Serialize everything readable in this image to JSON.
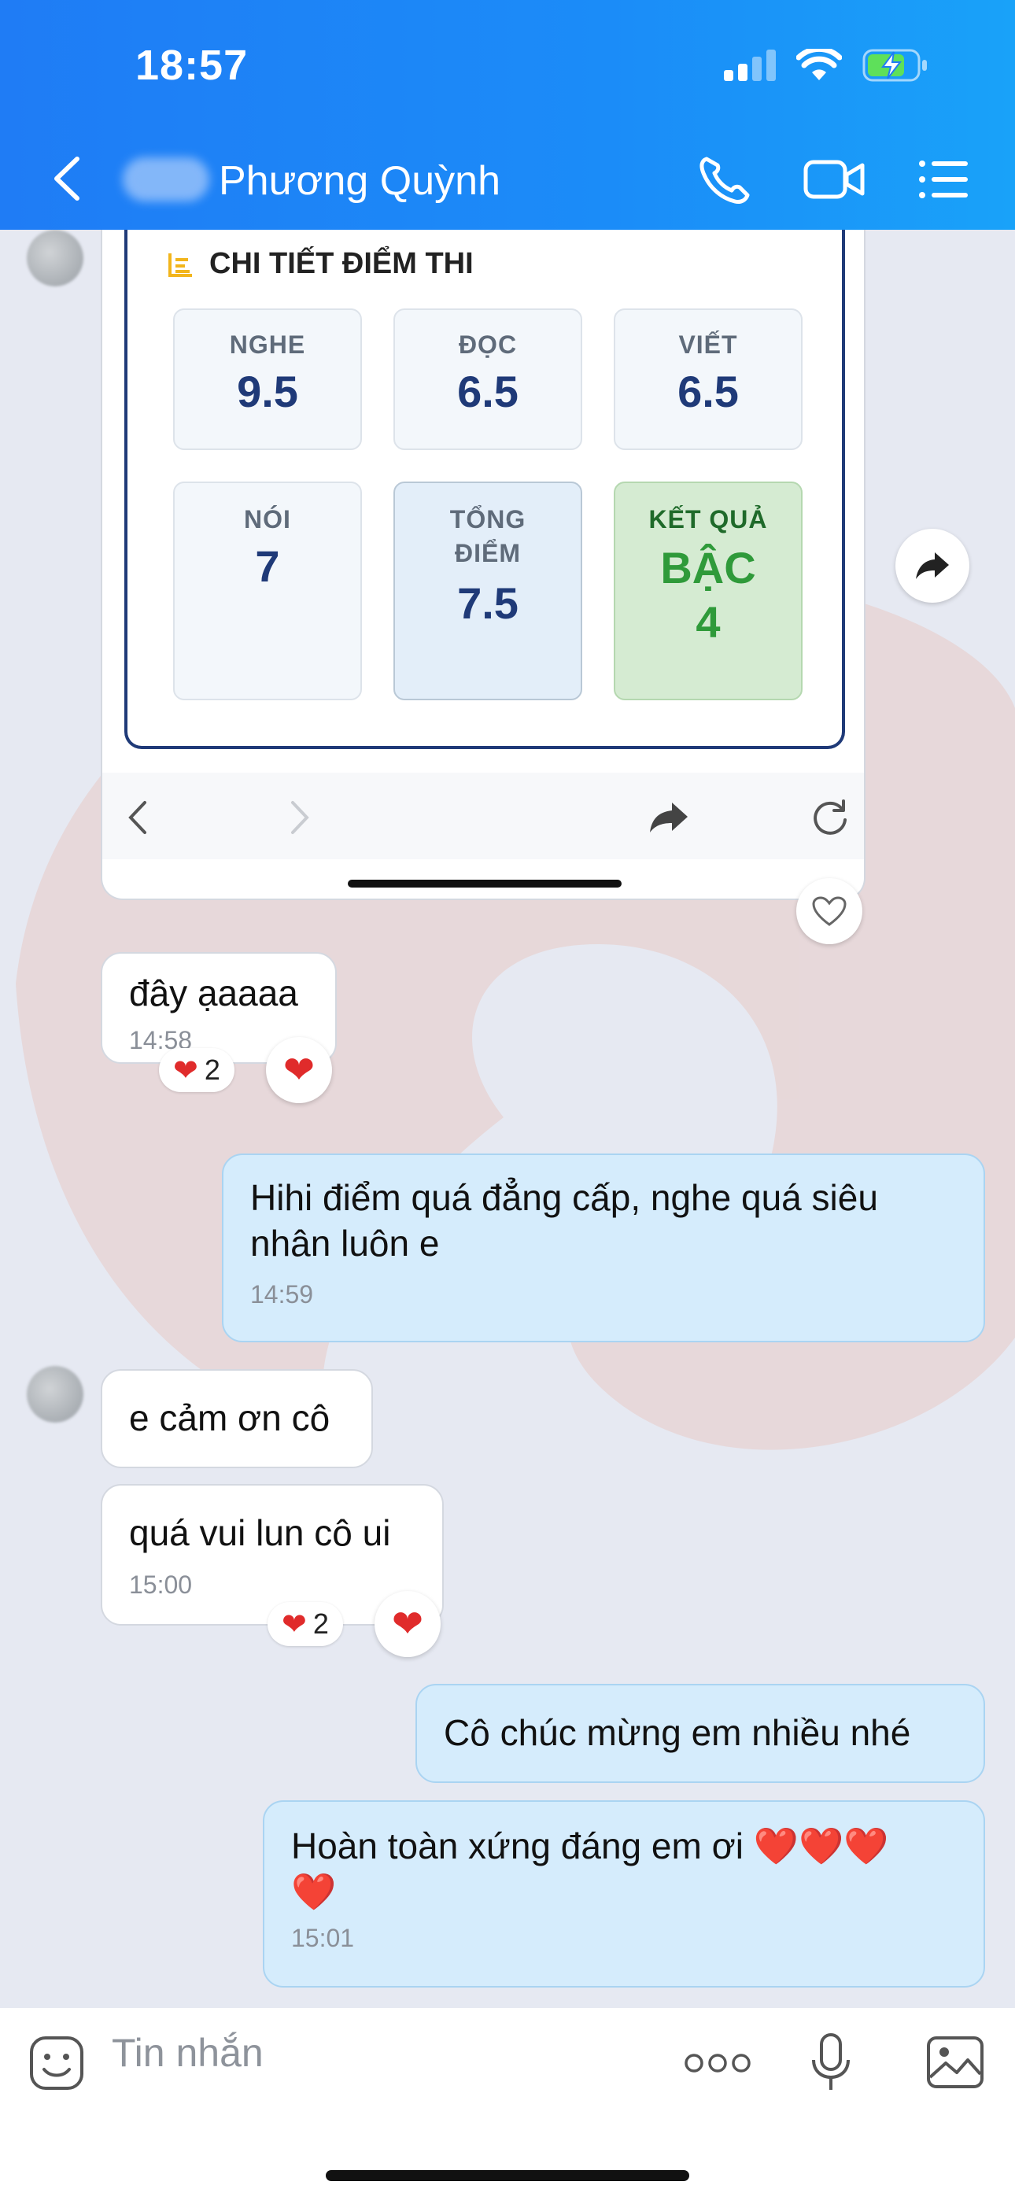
{
  "status_bar": {
    "time": "18:57"
  },
  "header": {
    "contact_name": "Phương Quỳnh"
  },
  "result_card": {
    "title": "CHI TIẾT ĐIỂM THI",
    "scores": [
      {
        "label": "NGHE",
        "value": "9.5"
      },
      {
        "label": "ĐỌC",
        "value": "6.5"
      },
      {
        "label": "VIẾT",
        "value": "6.5"
      },
      {
        "label": "NÓI",
        "value": "7"
      }
    ],
    "total": {
      "label_line1": "TỔNG",
      "label_line2": "ĐIỂM",
      "value": "7.5"
    },
    "result": {
      "label": "KẾT QUẢ",
      "value_line1": "BẬC",
      "value_line2": "4"
    }
  },
  "messages": [
    {
      "text": "đây ạaaaa",
      "time": "14:58",
      "reaction_count": "2"
    },
    {
      "text_line1": "Hihi điểm quá đẳng cấp, nghe quá siêu",
      "text_line2": "nhân luôn e",
      "time": "14:59"
    },
    {
      "text": "e cảm ơn cô"
    },
    {
      "text": "quá vui lun cô ui",
      "time": "15:00",
      "reaction_count": "2"
    },
    {
      "text": "Cô chúc mừng em nhiều nhé"
    },
    {
      "text_line1": "Hoàn toàn xứng đáng em ơi ❤️❤️❤️",
      "text_line2": "❤️",
      "time": "15:01"
    }
  ],
  "input": {
    "placeholder": "Tin nhắn"
  },
  "colors": {
    "header": "#1f7cf5",
    "out_bubble": "#d5ecfc",
    "in_bubble": "#ffffff",
    "score_text": "#1f3a78",
    "result_green": "#2f9a3a"
  }
}
